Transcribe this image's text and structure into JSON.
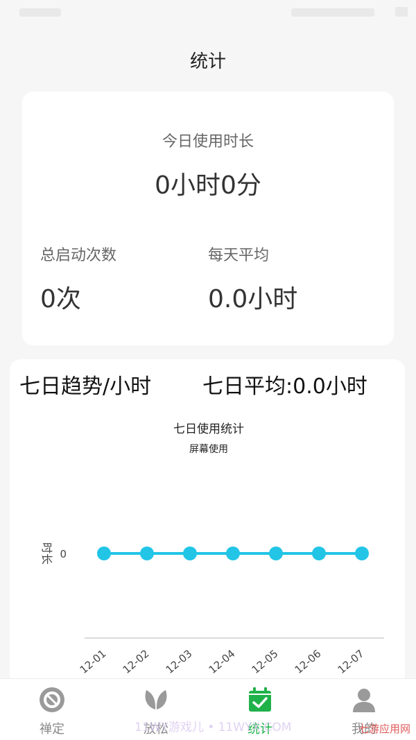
{
  "page": {
    "title": "统计"
  },
  "today": {
    "label": "今日使用时长",
    "value": "0小时0分",
    "total_launches_label": "总启动次数",
    "total_launches_value": "0次",
    "daily_avg_label": "每天平均",
    "daily_avg_value": "0.0小时"
  },
  "trend": {
    "header_left": "七日趋势/小时",
    "header_right": "七日平均:0.0小时"
  },
  "chart_data": {
    "type": "line",
    "title": "七日使用统计",
    "subtitle": "屏幕使用",
    "ylabel": "时长",
    "xlabel": "",
    "categories": [
      "12-01",
      "12-02",
      "12-03",
      "12-04",
      "12-05",
      "12-06",
      "12-07"
    ],
    "series": [
      {
        "values": [
          0,
          0,
          0,
          0,
          0,
          0,
          0
        ]
      }
    ],
    "y_ticks": [
      "0"
    ],
    "ylim": [
      0,
      0
    ],
    "grid": false,
    "line_color": "#22c5e6"
  },
  "nav": {
    "items": [
      {
        "label": "禅定",
        "icon": "target-icon"
      },
      {
        "label": "放松",
        "icon": "leaf-icon"
      },
      {
        "label": "统计",
        "icon": "calendar-check-icon"
      },
      {
        "label": "我的",
        "icon": "person-icon"
      }
    ],
    "active_color": "#20b24a",
    "inactive_color": "#9a9a9a"
  },
  "watermark": {
    "text": "11WY游戏儿 • 11WYX.COM"
  },
  "brand": {
    "text": "七游应用网"
  }
}
